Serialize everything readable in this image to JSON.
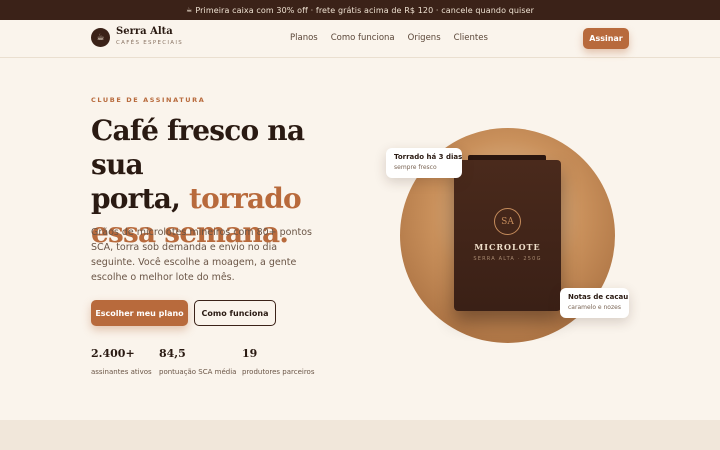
{
  "promo": {
    "icon": "coffee-icon",
    "text": "Primeira caixa com 30% off · frete grátis acima de R$ 120 · cancele quando quiser"
  },
  "brand": {
    "logo_icon": "coffee-cup-icon",
    "name": "Serra Alta",
    "tagline": "CAFÉS ESPECIAIS"
  },
  "nav": {
    "links": [
      "Planos",
      "Como funciona",
      "Origens",
      "Clientes"
    ],
    "cta": "Assinar"
  },
  "hero": {
    "eyebrow": "CLUBE DE ASSINATURA",
    "headline_line1": "Café fresco na sua",
    "headline_line2_plain": "porta, ",
    "headline_accent": "torrado essa semana.",
    "lede": "Grãos de microlotes mineiros com 80+ pontos SCA, torra sob demanda e envio no dia seguinte. Você escolhe a moagem, a gente escolhe o melhor lote do mês.",
    "primary_cta": "Escolher meu plano",
    "secondary_cta": "Como funciona"
  },
  "stats": [
    {
      "value": "2.400+",
      "label": "assinantes ativos"
    },
    {
      "value": "84,5",
      "label": "pontuação SCA média"
    },
    {
      "value": "19",
      "label": "produtores parceiros"
    }
  ],
  "product": {
    "seal": "SA",
    "title": "MICROLOTE",
    "subtitle": "SERRA ALTA · 250G"
  },
  "cards": {
    "roast_title": "Torrado há 3 dias",
    "roast_sub": "sempre fresco",
    "notes_title": "Notas de cacau",
    "notes_sub": "caramelo e nozes"
  },
  "colors": {
    "accent": "#b86a3c",
    "dark": "#3b2218",
    "background": "#faf4ec"
  }
}
